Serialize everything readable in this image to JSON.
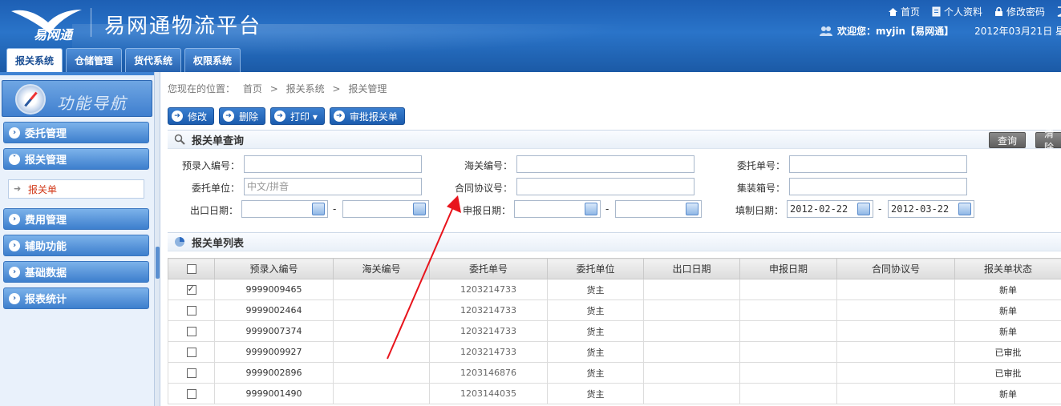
{
  "header": {
    "logo_text": "易网通",
    "app_title": "易网通物流平台",
    "links": [
      {
        "label": "首页",
        "icon": "home-icon"
      },
      {
        "label": "个人资料",
        "icon": "profile-icon"
      },
      {
        "label": "修改密码",
        "icon": "lock-icon"
      },
      {
        "label": "",
        "icon": "logout-icon"
      }
    ],
    "welcome": "欢迎您：myjin【易网通】",
    "date": "2012年03月21日 星"
  },
  "tabs": [
    "报关系统",
    "仓储管理",
    "货代系统",
    "权限系统"
  ],
  "sidebar": {
    "title": "功能导航",
    "menus": [
      "委托管理",
      "报关管理",
      "费用管理",
      "辅助功能",
      "基础数据",
      "报表统计"
    ],
    "active_sub": "报关单"
  },
  "breadcrumb": {
    "prefix": "您现在的位置：",
    "items": [
      "首页",
      ">",
      "报关系统",
      ">",
      "报关管理"
    ]
  },
  "toolbar": {
    "edit": "修改",
    "delete": "删除",
    "print": "打印 ▾",
    "approve": "审批报关单"
  },
  "query": {
    "title": "报关单查询",
    "search_btn": "查询",
    "clear_btn": "清除",
    "fields": {
      "pre_entry_no": {
        "label": "预录入编号：",
        "value": ""
      },
      "customs_no": {
        "label": "海关编号：",
        "value": ""
      },
      "order_no": {
        "label": "委托单号：",
        "value": ""
      },
      "client": {
        "label": "委托单位：",
        "placeholder": "中文/拼音"
      },
      "contract_no": {
        "label": "合同协议号：",
        "value": ""
      },
      "container_no": {
        "label": "集装箱号：",
        "value": ""
      },
      "export_date": {
        "label": "出口日期：",
        "from": "",
        "to": ""
      },
      "declare_date": {
        "label": "申报日期：",
        "from": "",
        "to": ""
      },
      "created_date": {
        "label": "填制日期：",
        "from": "2012-02-22",
        "to": "2012-03-22"
      }
    }
  },
  "list": {
    "title": "报关单列表",
    "columns": [
      "",
      "预录入编号",
      "海关编号",
      "委托单号",
      "委托单位",
      "出口日期",
      "申报日期",
      "合同协议号",
      "报关单状态"
    ],
    "rows": [
      {
        "checked": true,
        "pre_no": "9999009465",
        "customs_no": "",
        "order_no": "1203214733",
        "client": "货主",
        "export_date": "",
        "declare_date": "",
        "contract": "",
        "status": "新单"
      },
      {
        "checked": false,
        "pre_no": "9999002464",
        "customs_no": "",
        "order_no": "1203214733",
        "client": "货主",
        "export_date": "",
        "declare_date": "",
        "contract": "",
        "status": "新单"
      },
      {
        "checked": false,
        "pre_no": "9999007374",
        "customs_no": "",
        "order_no": "1203214733",
        "client": "货主",
        "export_date": "",
        "declare_date": "",
        "contract": "",
        "status": "新单"
      },
      {
        "checked": false,
        "pre_no": "9999009927",
        "customs_no": "",
        "order_no": "1203214733",
        "client": "货主",
        "export_date": "",
        "declare_date": "",
        "contract": "",
        "status": "已审批"
      },
      {
        "checked": false,
        "pre_no": "9999002896",
        "customs_no": "",
        "order_no": "1203146876",
        "client": "货主",
        "export_date": "",
        "declare_date": "",
        "contract": "",
        "status": "已审批"
      },
      {
        "checked": false,
        "pre_no": "9999001490",
        "customs_no": "",
        "order_no": "1203144035",
        "client": "货主",
        "export_date": "",
        "declare_date": "",
        "contract": "",
        "status": "新单"
      }
    ]
  },
  "colors": {
    "brand_blue": "#1d5fb4",
    "annotation_red": "#e8141c",
    "active_sub_text": "#d23a1a"
  }
}
